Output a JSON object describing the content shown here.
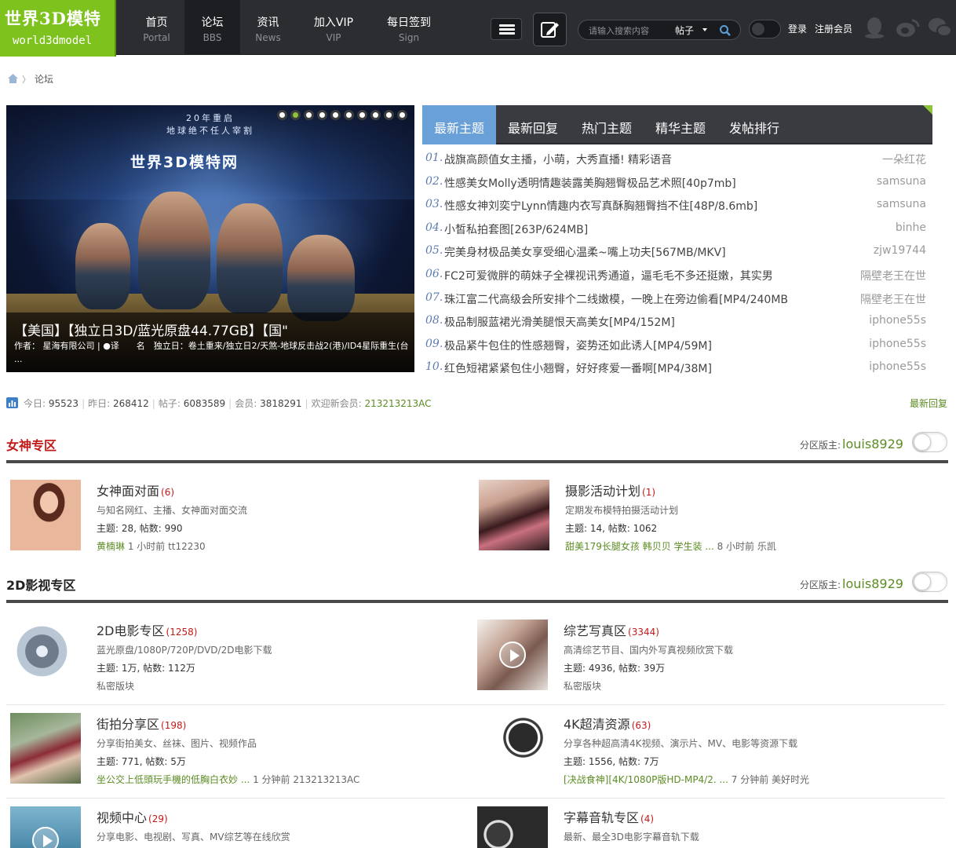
{
  "header": {
    "logo_cn": "世界3D模特",
    "logo_en": "world3dmodel",
    "nav": [
      {
        "title": "首页",
        "sub": "Portal"
      },
      {
        "title": "论坛",
        "sub": "BBS"
      },
      {
        "title": "资讯",
        "sub": "News"
      },
      {
        "title": "加入VIP",
        "sub": "VIP"
      },
      {
        "title": "每日签到",
        "sub": "Sign"
      }
    ],
    "search_placeholder": "请输入搜索内容",
    "search_scope": "帖子",
    "login": "登录",
    "register": "注册会员"
  },
  "breadcrumb": {
    "current": "论坛",
    "separator": "〉"
  },
  "slider": {
    "top_line1": "20年重启",
    "top_line2": "地球绝不任人宰割",
    "brand": "世界3D模特网",
    "caption_title": "【美国】【独立日3D/蓝光原盘44.77GB】【国\"",
    "caption_desc": "作者： 星海有限公司 | ●译　　名　独立日：卷土重来/独立日2/天煞-地球反击战2(港)/ID4星际重生(台 ...",
    "total_slides": 10,
    "active_slide": 2
  },
  "tabs": [
    "最新主题",
    "最新回复",
    "热门主题",
    "精华主题",
    "发帖排行"
  ],
  "threads": [
    {
      "num": "01.",
      "title": "战旗高颜值女主播，小萌，大秀直播! 精彩语音",
      "author": "一朵红花"
    },
    {
      "num": "02.",
      "title": "性感美女Molly透明情趣装露美胸翘臀极品艺术照[40p7mb]",
      "author": "samsuna"
    },
    {
      "num": "03.",
      "title": "性感女神刘奕宁Lynn情趣内衣写真酥胸翘臀挡不住[48P/8.6mb]",
      "author": "samsuna"
    },
    {
      "num": "04.",
      "title": "小皙私拍套图[263P/624MB]",
      "author": "binhe"
    },
    {
      "num": "05.",
      "title": "完美身材极品美女享受细心温柔~嘴上功夫[567MB/MKV]",
      "author": "zjw19744"
    },
    {
      "num": "06.",
      "title": "FC2可爱微胖的萌妹子全裸视讯秀通道，逼毛毛不多还挺嫩，其实男",
      "author": "隔壁老王在世"
    },
    {
      "num": "07.",
      "title": "珠江富二代高级会所安排个二线嫩模，一晚上在旁边偷看[MP4/240MB",
      "author": "隔壁老王在世"
    },
    {
      "num": "08.",
      "title": "极品制服蓝裙光滑美腿恨天高美女[MP4/152M]",
      "author": "iphone55s"
    },
    {
      "num": "09.",
      "title": "极品紧牛包住的性感翘臀，姿势还如此诱人[MP4/59M]",
      "author": "iphone55s"
    },
    {
      "num": "10.",
      "title": "红色短裙紧紧包住小翘臀，好好疼爱一番啊[MP4/38M]",
      "author": "iphone55s"
    }
  ],
  "stats": {
    "today_label": "今日:",
    "today": "95523",
    "yesterday_label": "昨日:",
    "yesterday": "268412",
    "posts_label": "帖子:",
    "posts": "6083589",
    "members_label": "会员:",
    "members": "3818291",
    "newest_label": "欢迎新会员:",
    "newest": "213213213AC",
    "latest_link": "最新回复"
  },
  "sections": [
    {
      "title": "女神专区",
      "mod_label": "分区版主:",
      "mod_user": "louis8929",
      "forums": [
        {
          "name": "女神面对面",
          "count": "(6)",
          "desc": "与知名网红、主播、女神面对面交流",
          "stats": "主题: 28, 帖数: 990",
          "last_link": "黄楠琳",
          "last_meta": " 1 小时前 tt12230"
        },
        {
          "name": "摄影活动计划",
          "count": "(1)",
          "desc": "定期发布模特拍摄活动计划",
          "stats": "主题: 14, 帖数: 1062",
          "last_link": "甜美179长腿女孩 韩贝贝 学生装 ...",
          "last_meta": " 8 小时前 乐凯"
        }
      ]
    },
    {
      "title": "2D影视专区",
      "mod_label": "分区版主:",
      "mod_user": "louis8929",
      "forums": [
        {
          "name": "2D电影专区",
          "count": "(1258)",
          "desc": "蓝光原盘/1080P/720P/DVD/2D电影下载",
          "stats": "主题: 1万, 帖数: 112万",
          "last_link": "",
          "last_meta": "私密版块"
        },
        {
          "name": "综艺写真区",
          "count": "(3344)",
          "desc": "高清综艺节目、国内外写真视频欣赏下载",
          "stats": "主题: 4936, 帖数: 39万",
          "last_link": "",
          "last_meta": "私密版块"
        },
        {
          "name": "街拍分享区",
          "count": "(198)",
          "desc": "分享街拍美女、丝袜、图片、视频作品",
          "stats": "主题: 771, 帖数: 5万",
          "last_link": "坐公交上低頭玩手機的低胸白衣妙 ...",
          "last_meta": " 1 分钟前 213213213AC"
        },
        {
          "name": "4K超清资源",
          "count": "(63)",
          "desc": "分享各种超高清4K视频、演示片、MV、电影等资源下载",
          "stats": "主题: 1556, 帖数: 7万",
          "last_link": "[决战食神][4K/1080P版HD-MP4/2. ...",
          "last_meta": " 7 分钟前 美好时光"
        },
        {
          "name": "视频中心",
          "count": "(29)",
          "desc": "分享电影、电视剧、写真、MV综艺等在线欣赏",
          "stats": "",
          "last_link": "",
          "last_meta": ""
        },
        {
          "name": "字幕音轨专区",
          "count": "(4)",
          "desc": "最新、最全3D电影字幕音轨下载",
          "stats": "",
          "last_link": "",
          "last_meta": ""
        }
      ]
    }
  ],
  "colors": {
    "accent_green": "#7ec21e",
    "link_green": "#5b8c23",
    "tab_active": "#6aa0d8",
    "count_red": "#c21a1a"
  }
}
